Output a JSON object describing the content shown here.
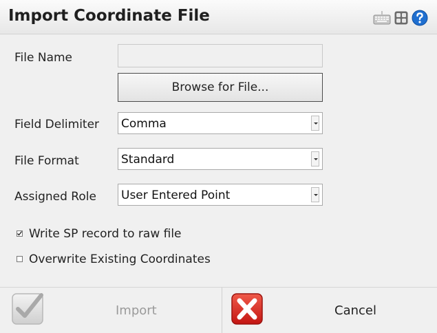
{
  "window": {
    "title": "Import Coordinate File",
    "icons": [
      "keyboard-icon",
      "grid-icon",
      "help-icon"
    ]
  },
  "form": {
    "file_name_label": "File Name",
    "file_name_value": "",
    "browse_label": "Browse for File...",
    "field_delimiter_label": "Field Delimiter",
    "field_delimiter_value": "Comma",
    "file_format_label": "File Format",
    "file_format_value": "Standard",
    "assigned_role_label": "Assigned Role",
    "assigned_role_value": "User Entered Point",
    "write_sp_label": "Write SP record to raw file",
    "write_sp_checked": true,
    "overwrite_label": "Overwrite Existing Coordinates",
    "overwrite_checked": false
  },
  "footer": {
    "import_label": "Import",
    "import_enabled": false,
    "cancel_label": "Cancel"
  },
  "colors": {
    "cancel_red": "#d8201f",
    "help_blue": "#1f6fd0",
    "disabled_text": "#9a9a9a"
  }
}
